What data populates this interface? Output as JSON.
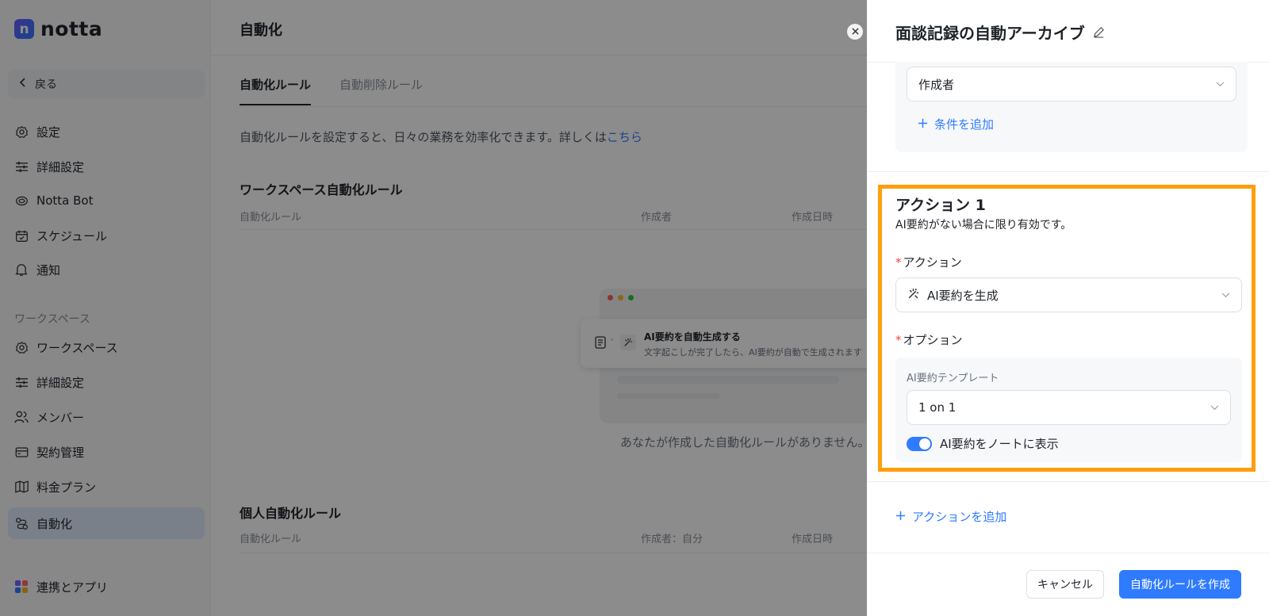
{
  "app": {
    "logo_letter": "n",
    "name": "notta"
  },
  "sidebar": {
    "back_label": "戻る",
    "items": [
      {
        "label": "設定",
        "icon": "gear-icon"
      },
      {
        "label": "詳細設定",
        "icon": "sliders-icon"
      },
      {
        "label": "Notta Bot",
        "icon": "bot-icon"
      },
      {
        "label": "スケジュール",
        "icon": "calendar-icon"
      },
      {
        "label": "通知",
        "icon": "bell-icon"
      }
    ],
    "workspace_label": "ワークスペース",
    "workspace_items": [
      {
        "label": "ワークスペース",
        "icon": "gear-icon"
      },
      {
        "label": "詳細設定",
        "icon": "sliders-icon"
      },
      {
        "label": "メンバー",
        "icon": "users-icon"
      },
      {
        "label": "契約管理",
        "icon": "card-icon"
      },
      {
        "label": "料金プラン",
        "icon": "map-icon"
      },
      {
        "label": "自動化",
        "icon": "automation-icon"
      }
    ],
    "integrations_label": "連携とアプリ"
  },
  "main": {
    "title": "自動化",
    "tabs": [
      "自動化ルール",
      "自動削除ルール"
    ],
    "description": "自動化ルールを設定すると、日々の業務を効率化できます。詳しくは",
    "description_link": "こちら",
    "workspace_section": {
      "title": "ワークスペース自動化ルール",
      "columns": [
        "自動化ルール",
        "作成者",
        "作成日時"
      ]
    },
    "illustration": {
      "card_title": "AI要約を自動生成する",
      "card_subtitle": "文字起こしが完了したら、AI要約が自動で生成されます"
    },
    "empty_text": "あなたが作成した自動化ルールがありません。",
    "personal_section": {
      "title": "個人自動化ルール",
      "columns": [
        "自動化ルール",
        "作成者：自分",
        "作成日時"
      ]
    }
  },
  "drawer": {
    "title": "面談記録の自動アーカイブ",
    "condition_select_value": "作成者",
    "add_condition_label": "条件を追加",
    "action": {
      "title": "アクション 1",
      "subtitle": "AI要約がない場合に限り有効です。",
      "action_label": "アクション",
      "action_value": "AI要約を生成",
      "option_label": "オプション",
      "template_label": "AI要約テンプレート",
      "template_value": "1 on 1",
      "toggle_label": "AI要約をノートに表示",
      "toggle_on": true
    },
    "add_action_label": "アクションを追加",
    "cancel_label": "キャンセル",
    "create_label": "自動化ルールを作成"
  },
  "colors": {
    "accent": "#2f7bff",
    "highlight": "#ff9e0d",
    "required": "#f04444"
  }
}
